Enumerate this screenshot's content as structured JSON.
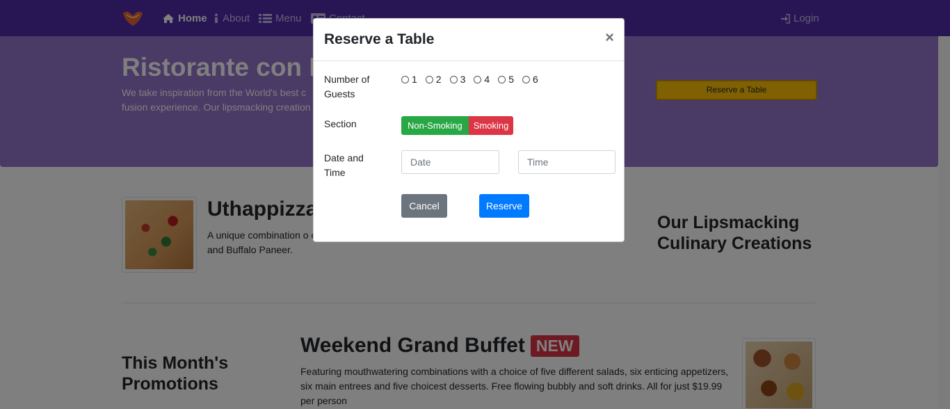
{
  "navbar": {
    "items": [
      {
        "label": "Home",
        "icon": "home-icon"
      },
      {
        "label": "About",
        "icon": "info-icon"
      },
      {
        "label": "Menu",
        "icon": "list-icon"
      },
      {
        "label": "Contact",
        "icon": "address-card-icon"
      }
    ],
    "login": "Login",
    "color": "#512da8"
  },
  "jumbotron": {
    "title": "Ristorante con Fu",
    "text": "We take inspiration from the World's best c fusion experience. Our lipsmacking creation",
    "reserve_button": "Reserve a Table",
    "color": "#9575cd"
  },
  "featured": {
    "dish_title": "Uthappizza",
    "dish_desc": "A unique combination o olives, ripe vine cherry tomatoes, Vidalia onion, Guntur chillies and Buffalo Paneer.",
    "section_heading": "Our Lipsmacking Culinary Creations"
  },
  "promotions": {
    "section_heading": "This Month's Promotions",
    "title": "Weekend Grand Buffet",
    "badge": "NEW",
    "desc": "Featuring mouthwatering combinations with a choice of five different salads, six enticing appetizers, six main entrees and five choicest desserts. Free flowing bubbly and soft drinks. All for just $19.99 per person"
  },
  "modal": {
    "title": "Reserve a Table",
    "close": "×",
    "guests_label": "Number of Guests",
    "guest_options": [
      "1",
      "2",
      "3",
      "4",
      "5",
      "6"
    ],
    "section_label": "Section",
    "non_smoking": "Non-Smoking",
    "smoking": "Smoking",
    "datetime_label": "Date and Time",
    "date_placeholder": "Date",
    "time_placeholder": "Time",
    "cancel": "Cancel",
    "reserve": "Reserve"
  }
}
